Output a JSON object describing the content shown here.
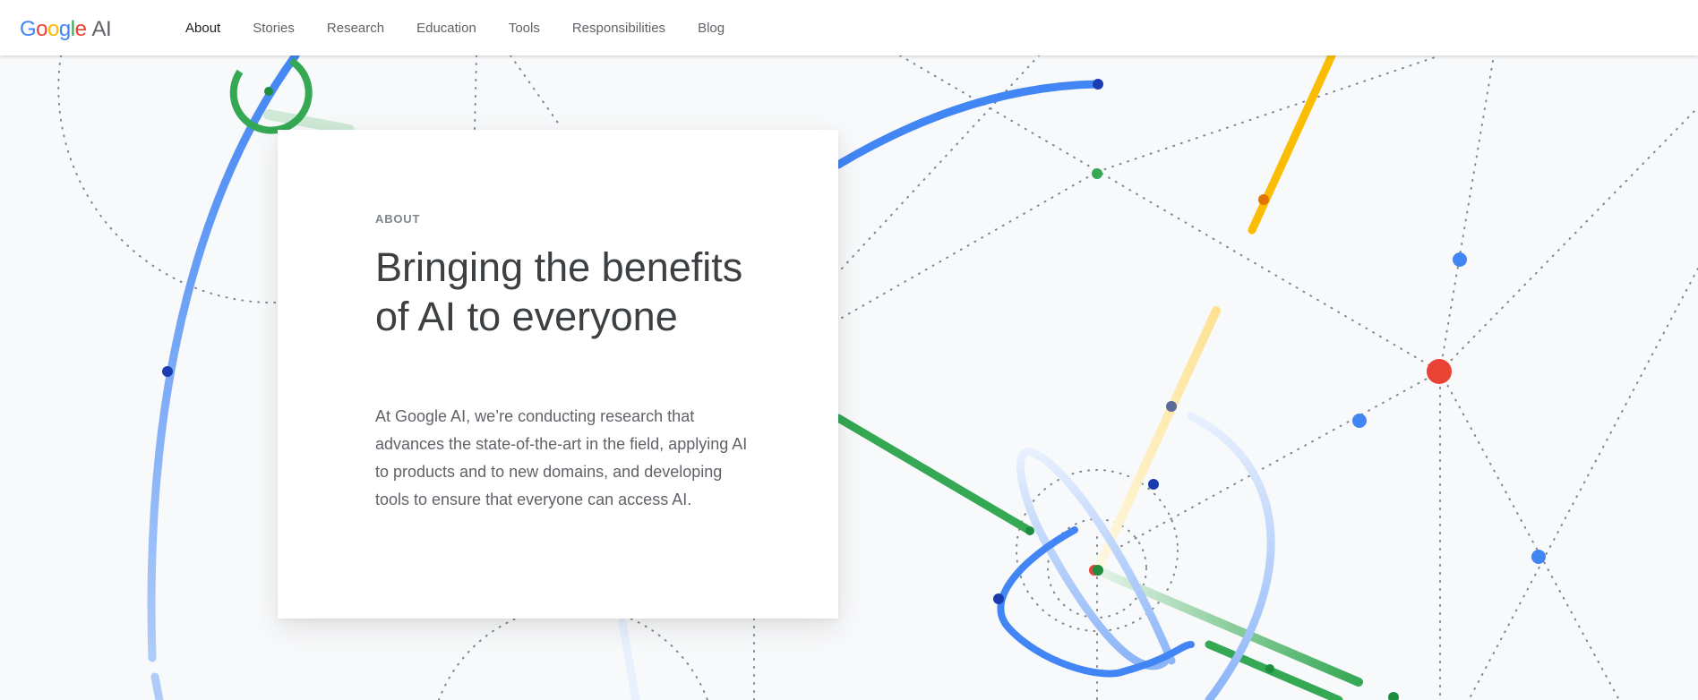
{
  "brand": {
    "logo_letters": [
      "G",
      "o",
      "o",
      "g",
      "l",
      "e"
    ],
    "logo_suffix": "AI"
  },
  "nav": {
    "items": [
      {
        "label": "About",
        "active": true
      },
      {
        "label": "Stories"
      },
      {
        "label": "Research"
      },
      {
        "label": "Education"
      },
      {
        "label": "Tools"
      },
      {
        "label": "Responsibilities"
      },
      {
        "label": "Blog"
      }
    ]
  },
  "hero": {
    "eyebrow": "ABOUT",
    "headline": "Bringing the benefits of AI to everyone",
    "description": "At Google AI, we’re conducting research that advances the state-of-the-art in the field, applying AI to products and to new domains, and developing tools to ensure that everyone can access AI."
  },
  "colors": {
    "blue": "#4285f4",
    "red": "#ea4335",
    "yellow": "#fbbc05",
    "green": "#34a853",
    "dark_blue": "#1a3cb0",
    "background": "#f8f9fa"
  }
}
